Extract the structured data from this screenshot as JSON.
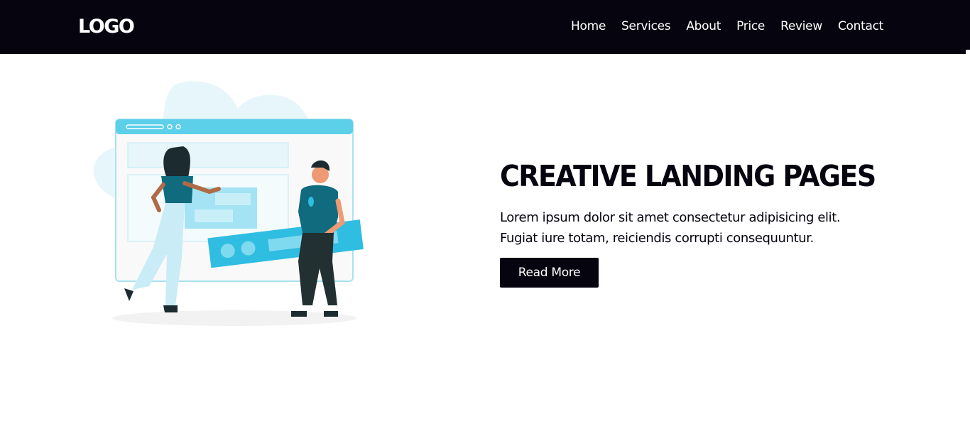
{
  "header": {
    "logo": "LOGO",
    "nav": [
      {
        "label": "Home"
      },
      {
        "label": "Services"
      },
      {
        "label": "About"
      },
      {
        "label": "Price"
      },
      {
        "label": "Review"
      },
      {
        "label": "Contact"
      }
    ]
  },
  "hero": {
    "title": "CREATIVE LANDING PAGES",
    "body_line_1": "Lorem ipsum dolor sit amet consectetur adipisicing elit.",
    "body_line_2": "Fugiat iure totam, reiciendis corrupti consequuntur.",
    "button_label": "Read More",
    "illustration": "people-building-website-illustration"
  },
  "colors": {
    "header_bg": "#05040f",
    "accent": "#5ccfe9",
    "accent_light": "#e6f6fb",
    "text": "#05040f",
    "button_bg": "#05040f"
  }
}
